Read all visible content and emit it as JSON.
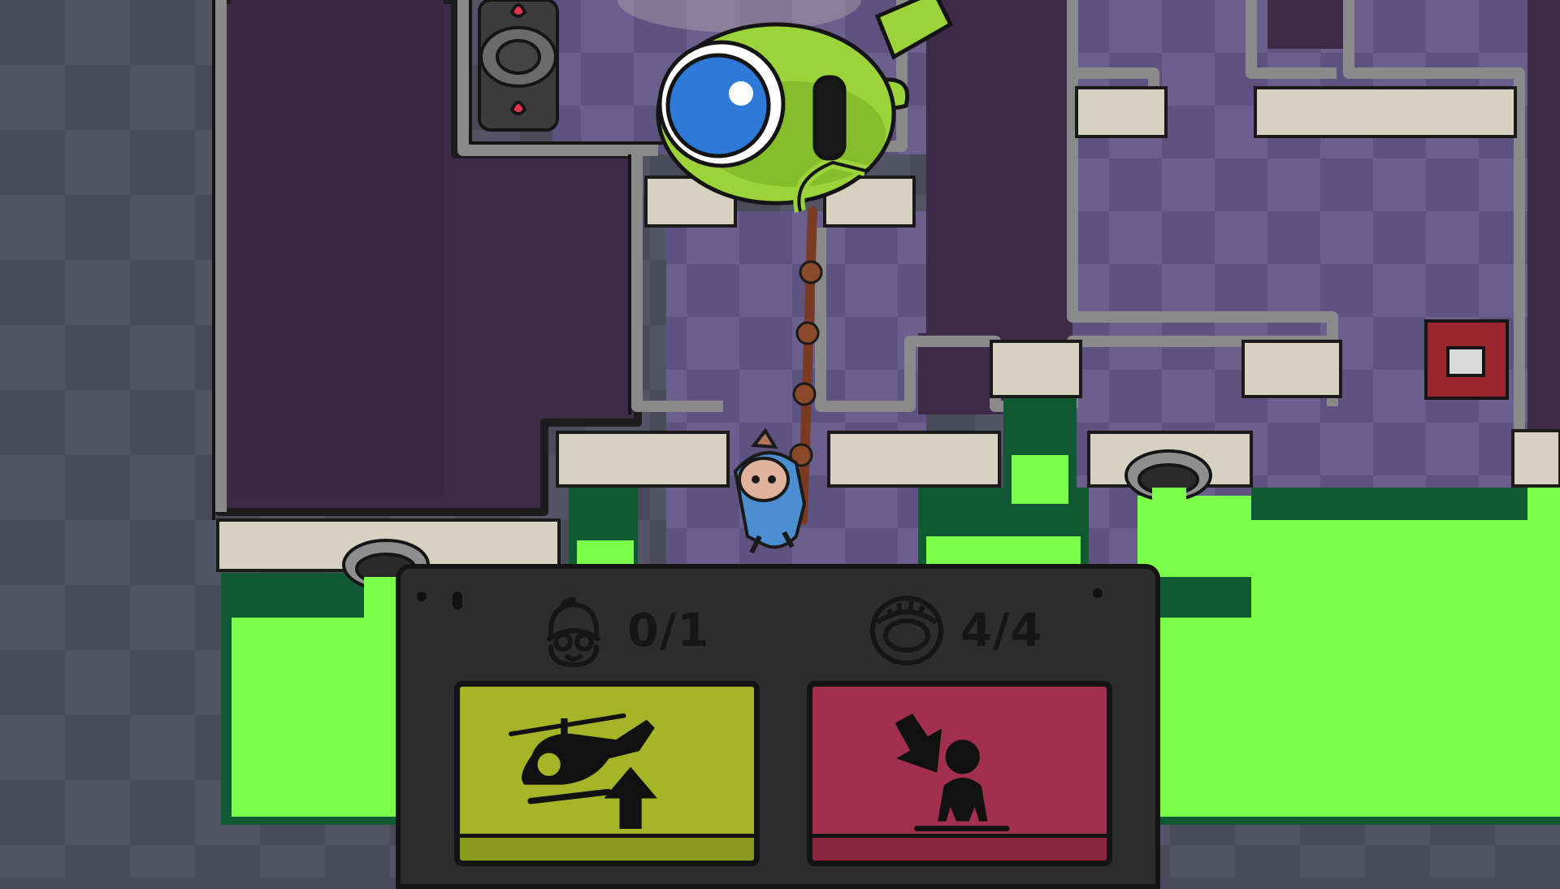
{
  "hud": {
    "rescued_label": "0/1",
    "rescued_icon": "survivor-face-icon",
    "collectibles_label": "4/4",
    "collectibles_icon": "ring-icon"
  },
  "actions": {
    "lift_button": {
      "icon": "helicopter-up-icon",
      "color": "#a4b528"
    },
    "drop_button": {
      "icon": "drop-person-icon",
      "color": "#a0304d"
    }
  },
  "colors": {
    "acid": "#7cff4a",
    "helicopter": "#9cd33b",
    "room_floor": "#3d2a46",
    "tiles_light": "#6e6290",
    "tiles_dark": "#5a5078"
  }
}
